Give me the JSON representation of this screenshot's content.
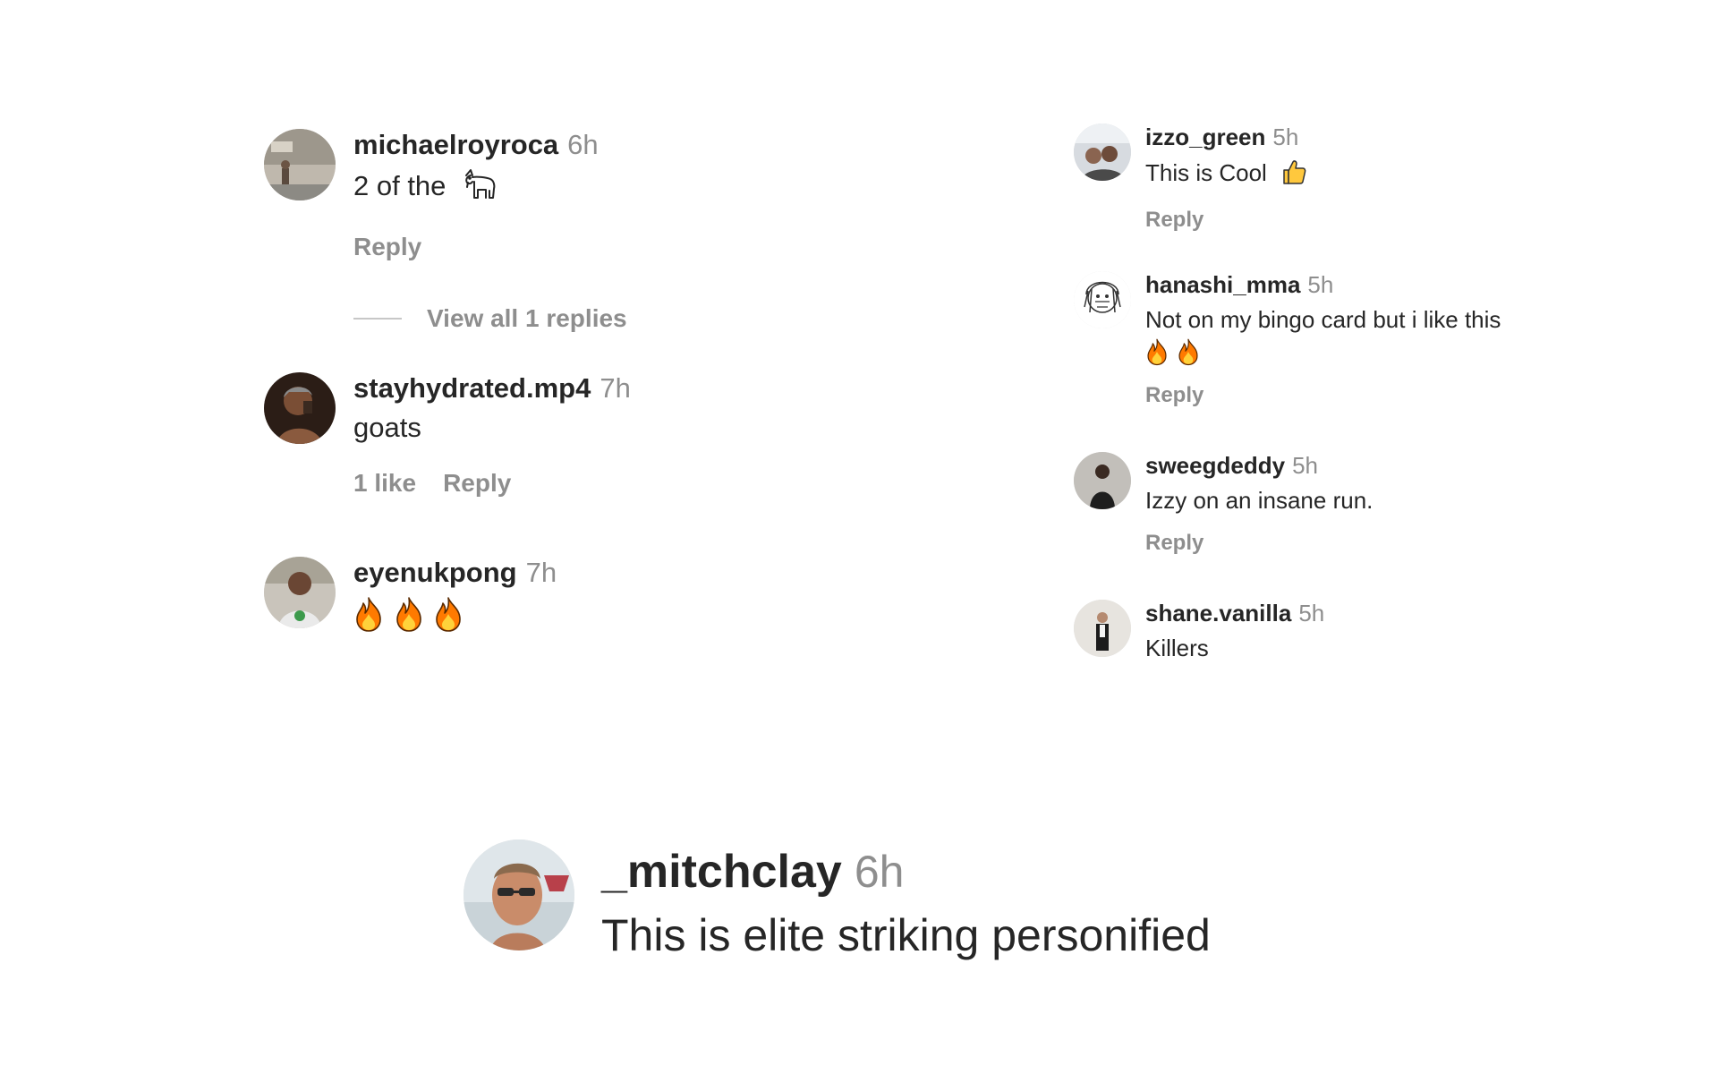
{
  "left_comments": [
    {
      "username": "michaelroyroca",
      "time": "6h",
      "text": "2 of the",
      "emoji": "goat-icon",
      "reply": "Reply",
      "view_replies": "View all 1 replies"
    },
    {
      "username": "stayhydrated.mp4",
      "time": "7h",
      "text": "goats",
      "likes": "1 like",
      "reply": "Reply"
    },
    {
      "username": "eyenukpong",
      "time": "7h",
      "emoji": "fire-icon",
      "emoji_count": 3
    }
  ],
  "right_comments": [
    {
      "username": "izzo_green",
      "time": "5h",
      "text": "This is Cool",
      "emoji": "thumbs-up-icon",
      "reply": "Reply"
    },
    {
      "username": "hanashi_mma",
      "time": "5h",
      "text": "Not on my bingo card but i like this",
      "emoji": "fire-icon",
      "emoji_count": 2,
      "reply": "Reply"
    },
    {
      "username": "sweegdeddy",
      "time": "5h",
      "text": "Izzy on an insane run.",
      "reply": "Reply"
    },
    {
      "username": "shane.vanilla",
      "time": "5h",
      "text": "Killers"
    }
  ],
  "featured_comment": {
    "username": "_mitchclay",
    "time": "6h",
    "text": "This is elite striking personified"
  },
  "colors": {
    "text": "#262626",
    "muted": "#8e8e8e",
    "fire": "#ff7a00",
    "thumb": "#ffc83d"
  }
}
